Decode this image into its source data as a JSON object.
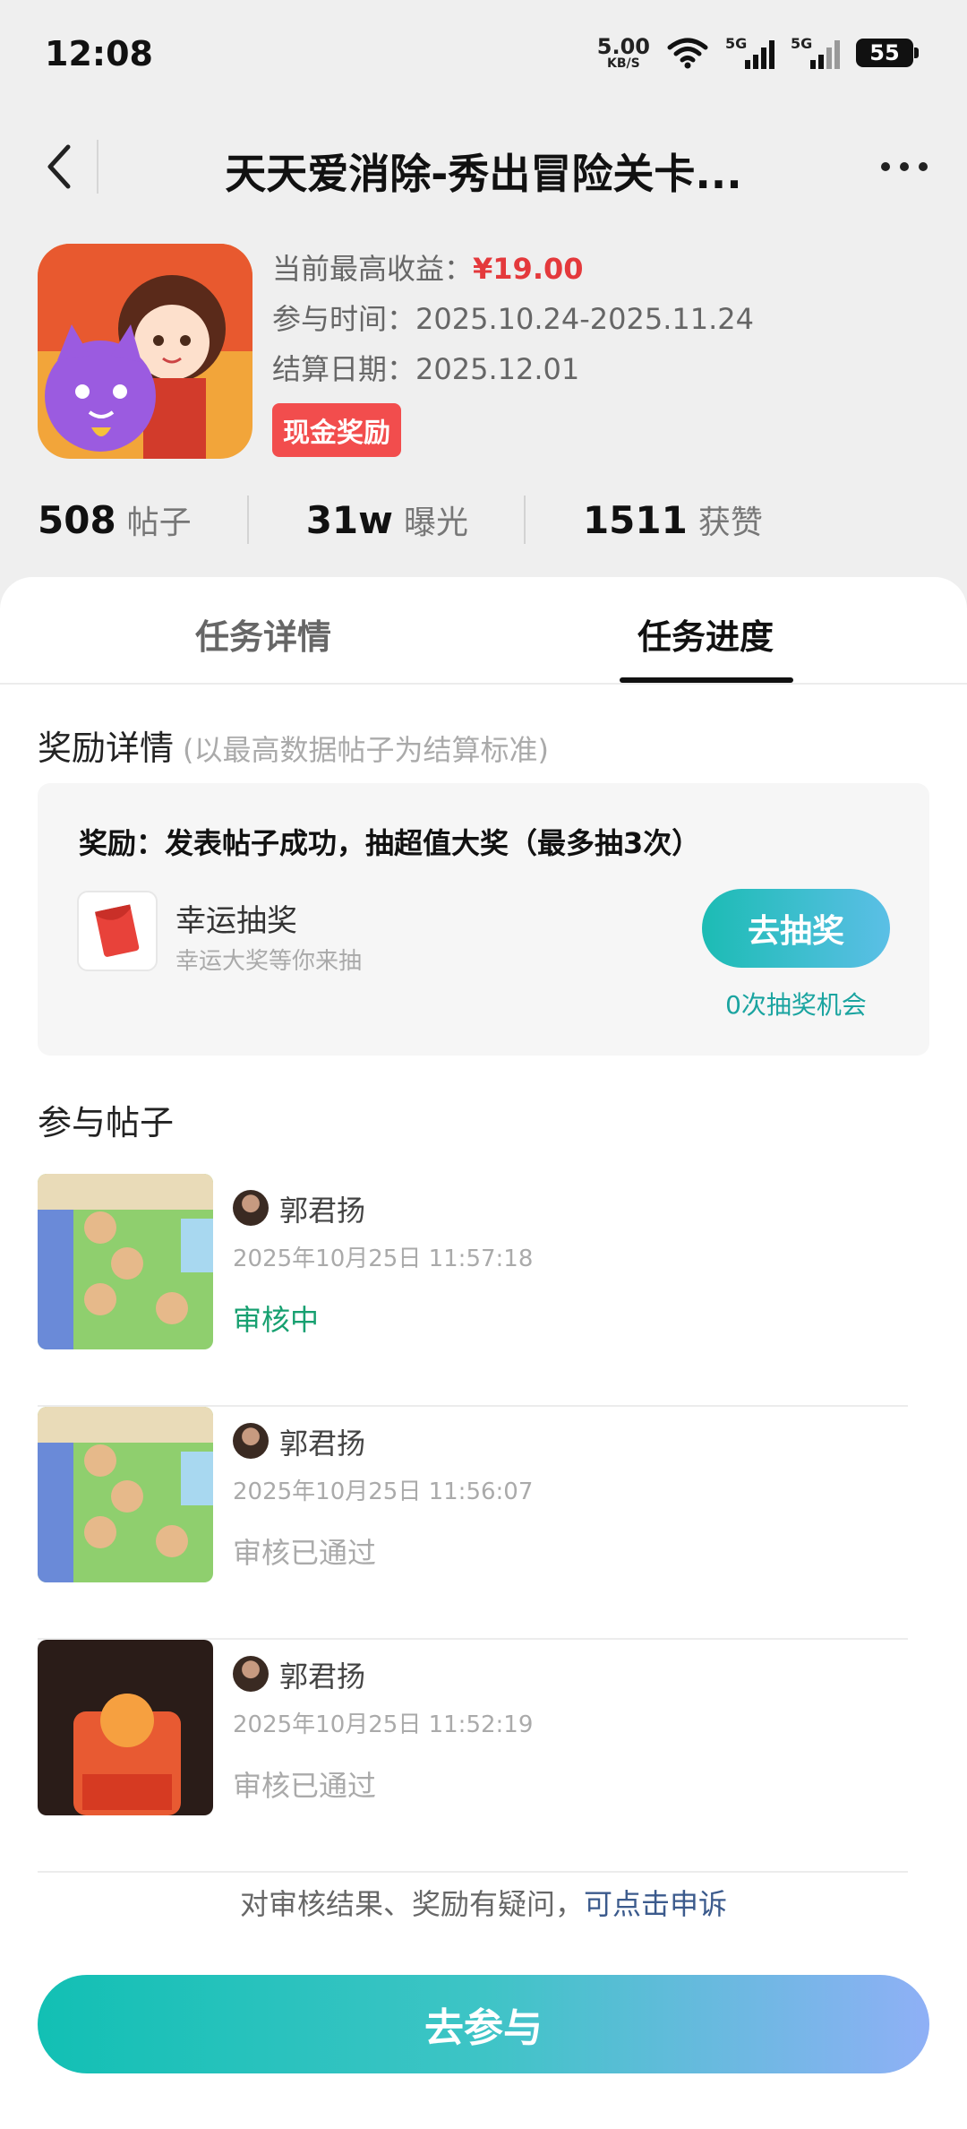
{
  "status_bar": {
    "time": "12:08",
    "net_speed": "5.00",
    "net_unit": "KB/S",
    "sim1": "5G",
    "sim2": "5G",
    "battery": "55"
  },
  "nav": {
    "title": "天天爱消除-秀出冒险关卡..."
  },
  "header": {
    "max_income_label": "当前最高收益：",
    "max_income_value": "¥19.00",
    "participate_label": "参与时间：",
    "participate_value": "2025.10.24-2025.11.24",
    "settle_label": "结算日期：",
    "settle_value": "2025.12.01",
    "badge": "现金奖励"
  },
  "stats": [
    {
      "value": "508",
      "label": "帖子"
    },
    {
      "value": "31w",
      "label": "曝光"
    },
    {
      "value": "1511",
      "label": "获赞"
    }
  ],
  "tabs": [
    {
      "label": "任务详情",
      "active": false
    },
    {
      "label": "任务进度",
      "active": true
    }
  ],
  "reward": {
    "title": "奖励详情",
    "subtitle": "(以最高数据帖子为结算标准)",
    "desc": "奖励：发表帖子成功，抽超值大奖（最多抽3次）",
    "lucky_title": "幸运抽奖",
    "lucky_sub": "幸运大奖等你来抽",
    "draw_button": "去抽奖",
    "chances": "0次抽奖机会"
  },
  "posts_section_title": "参与帖子",
  "posts": [
    {
      "author": "郭君扬",
      "time": "2025年10月25日 11:57:18",
      "status": "审核中"
    },
    {
      "author": "郭君扬",
      "time": "2025年10月25日 11:56:07",
      "status": "审核已通过"
    },
    {
      "author": "郭君扬",
      "time": "2025年10月25日 11:52:19",
      "status": "审核已通过"
    }
  ],
  "appeal": {
    "text": "对审核结果、奖励有疑问，",
    "link": "可点击申诉"
  },
  "join_button": "去参与",
  "colors": {
    "accent_teal": "#12c0b4",
    "price_red": "#e4393c",
    "pending_green": "#17a070"
  }
}
